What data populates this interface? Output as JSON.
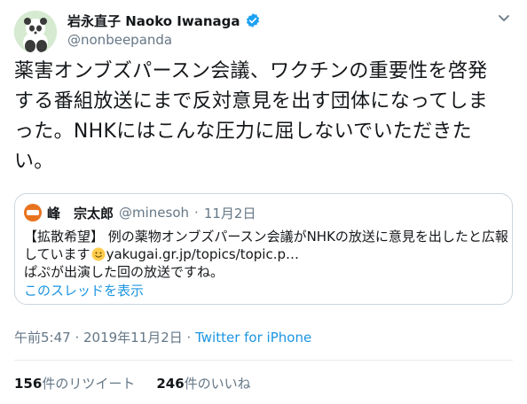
{
  "author": {
    "display_name": "岩永直子 Naoko Iwanaga",
    "handle": "@nonbeepanda",
    "verified": true
  },
  "tweet": {
    "lines": [
      "薬害オンブズパースン会議、ワクチンの重要性を啓発",
      "する番組放送にまで反対意見を出す団体になってしま",
      "った。NHKにはこんな圧力に屈しないでいただきた",
      "い。"
    ]
  },
  "quoted": {
    "name": "峰　宗太郎",
    "handle": "@minesoh",
    "separator": "·",
    "date": "11月2日",
    "line1": "【拡散希望】 例の薬物オンブズパースン会議がNHKの放送に意見を出したと広報",
    "line2_prefix": "しています",
    "line2_link": "yakugai.gr.jp/topics/topic.p…",
    "line3": "ぱぷが出演した回の放送ですね。",
    "thread_link": "このスレッドを表示"
  },
  "meta": {
    "time": "午前5:47 · 2019年11月2日 · ",
    "client": "Twitter for iPhone"
  },
  "stats": {
    "retweets_count": "156",
    "retweets_label": "件のリツイート",
    "likes_count": "246",
    "likes_label": "件のいいね"
  },
  "colors": {
    "link": "#1b95e0",
    "muted": "#657786",
    "border": "#ccd6dd",
    "verified": "#1da1f2"
  },
  "icons": {
    "avatar": "panda-avatar",
    "verified": "verified-badge-icon",
    "caret": "chevron-down-icon",
    "emoji": "smiling-face-icon"
  }
}
